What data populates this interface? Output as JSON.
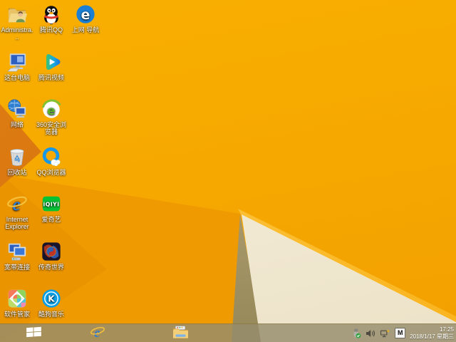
{
  "desktop": {
    "icons": [
      {
        "id": "administrator",
        "label": "Administra...",
        "icon": "user-folder",
        "col": 0,
        "row": 0
      },
      {
        "id": "tencent-qq",
        "label": "腾讯QQ",
        "icon": "qq-penguin",
        "col": 1,
        "row": 0
      },
      {
        "id": "web-navigation",
        "label": "上网 导航",
        "icon": "nav-blue-e",
        "col": 2,
        "row": 0
      },
      {
        "id": "this-pc",
        "label": "这台电脑",
        "icon": "computer",
        "col": 0,
        "row": 1
      },
      {
        "id": "tencent-video",
        "label": "腾讯视频",
        "icon": "tencent-video",
        "col": 1,
        "row": 1
      },
      {
        "id": "network",
        "label": "网络",
        "icon": "network-globe",
        "col": 0,
        "row": 2
      },
      {
        "id": "360-safe-browser",
        "label": "360安全浏览器",
        "icon": "browser-360",
        "col": 1,
        "row": 2
      },
      {
        "id": "recycle-bin",
        "label": "回收站",
        "icon": "recycle-bin",
        "col": 0,
        "row": 3
      },
      {
        "id": "qq-browser",
        "label": "QQ浏览器",
        "icon": "qq-browser",
        "col": 1,
        "row": 3
      },
      {
        "id": "internet-explorer",
        "label": "Internet Explorer",
        "icon": "ie-e",
        "col": 0,
        "row": 4
      },
      {
        "id": "iqiyi",
        "label": "爱奇艺",
        "icon": "iqiyi",
        "col": 1,
        "row": 4
      },
      {
        "id": "broadband",
        "label": "宽带连接",
        "icon": "broadband",
        "col": 0,
        "row": 5
      },
      {
        "id": "legend-world",
        "label": "传奇世界",
        "icon": "game-dragon",
        "col": 1,
        "row": 5
      },
      {
        "id": "software-manager",
        "label": "软件管家",
        "icon": "software-manager",
        "col": 0,
        "row": 6
      },
      {
        "id": "kugou-music",
        "label": "酷狗音乐",
        "icon": "kugou",
        "col": 1,
        "row": 6
      }
    ]
  },
  "logo_text": {
    "iqiyi": "iQIYI",
    "kugou": "K",
    "ie": "e",
    "nav": "e",
    "b360": "e"
  },
  "taskbar": {
    "tray": {
      "time": "17:25",
      "date": "2018/1/17 星期三",
      "ime_indicator": "M"
    }
  },
  "colors": {
    "wallpaper_orange": "#F6A800",
    "wallpaper_shadow_orange": "#EE9A00",
    "wallpaper_dark_triangle": "#D4700E",
    "wallpaper_tan_wedge": "#AE9D6B",
    "wallpaper_cream_triangle": "#F6EFDC",
    "wallpaper_edge_highlight": "#FFC843",
    "taskbar_tan": "#AC9152"
  }
}
